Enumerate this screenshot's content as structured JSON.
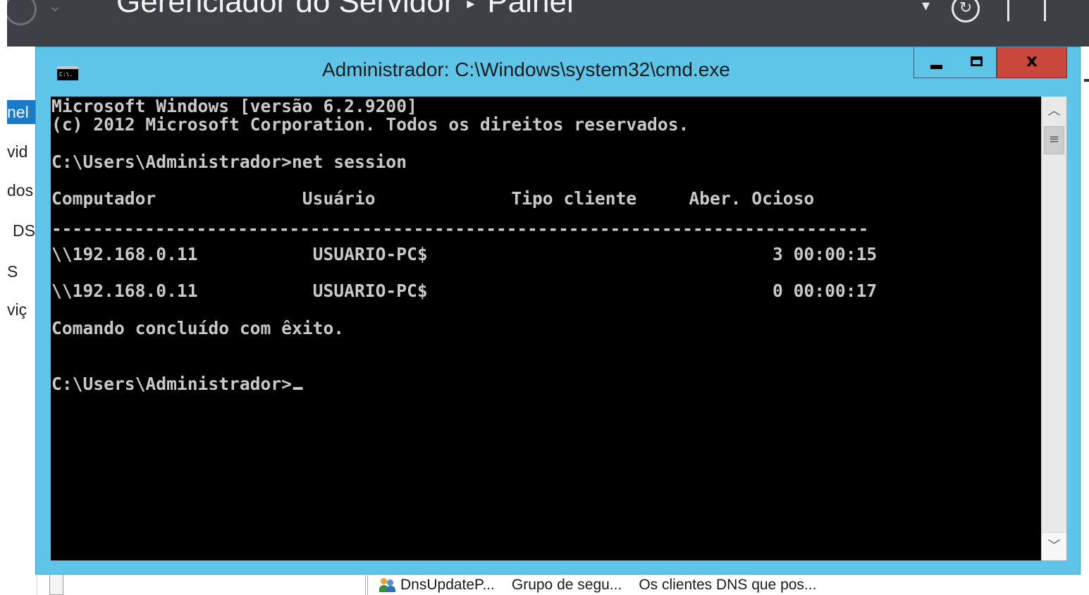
{
  "server_manager": {
    "breadcrumb": [
      "Gerenciador do Servidor",
      "Painel"
    ],
    "nav_items": [
      "nel",
      "vid",
      "dos",
      "DS",
      "S",
      "viç"
    ],
    "bg_row": {
      "name": "DnsUpdateP...",
      "type": "Grupo de segu...",
      "description": "Os clientes DNS que pos..."
    }
  },
  "cmd": {
    "icon_text": "C:\\.",
    "title": "Administrador: C:\\Windows\\system32\\cmd.exe",
    "close_label": "x",
    "lines": [
      "Microsoft Windows [versão 6.2.9200]",
      "(c) 2012 Microsoft Corporation. Todos os direitos reservados.",
      "C:\\Users\\Administrador>net session",
      "Computador              Usuário             Tipo cliente     Aber. Ocioso",
      "-------------------------------------------------------------------------------",
      "\\\\192.168.0.11           USUARIO-PC$                                 3 00:00:15",
      "\\\\192.168.0.11           USUARIO-PC$                                 0 00:00:17",
      "Comando concluído com êxito.",
      "C:\\Users\\Administrador>"
    ]
  },
  "colors": {
    "window_frame": "#5ec5e9",
    "console_bg": "#000000",
    "console_text": "#c9c9c9",
    "close_button": "#c9483b",
    "nav_active": "#1979ca",
    "header_bg": "#3e4046"
  },
  "icons": [
    "back-arrow-icon",
    "refresh-icon",
    "cmd-icon",
    "minimize-icon",
    "maximize-icon",
    "close-icon",
    "scroll-up-arrow-icon",
    "scroll-down-arrow-icon",
    "group-icon"
  ]
}
